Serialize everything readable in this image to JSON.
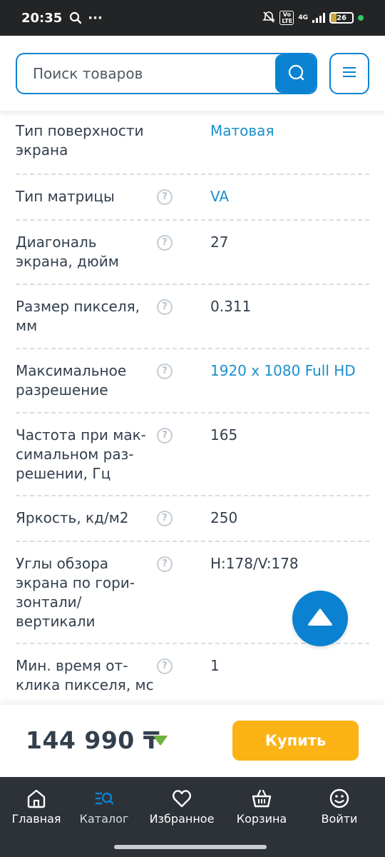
{
  "status_bar": {
    "time": "20:35",
    "more": "···",
    "network": "4G",
    "volte": "Vo LTE",
    "battery": "26"
  },
  "search": {
    "placeholder": "Поиск товаров",
    "value": ""
  },
  "specs": [
    {
      "label": "Тип поверхности экрана",
      "value": "Матовая",
      "has_help": false,
      "value_is_link": true
    },
    {
      "label": "Тип матрицы",
      "value": "VA",
      "has_help": true,
      "value_is_link": true
    },
    {
      "label": "Диагональ экрана, дюйм",
      "value": "27",
      "has_help": true,
      "value_is_link": false
    },
    {
      "label": "Размер пикселя, мм",
      "value": "0.311",
      "has_help": true,
      "value_is_link": false
    },
    {
      "label": "Максимальное разрешение",
      "value": "1920 x 1080 Full HD",
      "has_help": true,
      "value_is_link": true
    },
    {
      "label": "Частота при мак-симальном раз-решении, Гц",
      "value": "165",
      "has_help": true,
      "value_is_link": false
    },
    {
      "label": "Яркость, кд/м2",
      "value": "250",
      "has_help": true,
      "value_is_link": false
    },
    {
      "label": "Углы обзора экрана по гори-зонтали/ вертикали",
      "value": "H:178/V:178",
      "has_help": true,
      "value_is_link": false
    },
    {
      "label": "Мин. время от-клика пикселя, мс",
      "value": "1",
      "has_help": true,
      "value_is_link": false
    }
  ],
  "help_mark": "?",
  "buy_bar": {
    "price": "144 990 ₸",
    "buy_label": "Купить"
  },
  "bottom_nav": {
    "items": [
      {
        "label": "Главная",
        "icon": "home-icon"
      },
      {
        "label": "Каталог",
        "icon": "catalog-icon",
        "active": true
      },
      {
        "label": "Избранное",
        "icon": "heart-icon"
      },
      {
        "label": "Корзина",
        "icon": "basket-icon"
      },
      {
        "label": "Войти",
        "icon": "smiley-icon"
      }
    ]
  },
  "colors": {
    "accent": "#0b82d1",
    "buy": "#fcb315",
    "link": "#1a8fcc",
    "nav_bg": "#2d3239",
    "price_badge": "#6cb33f"
  }
}
